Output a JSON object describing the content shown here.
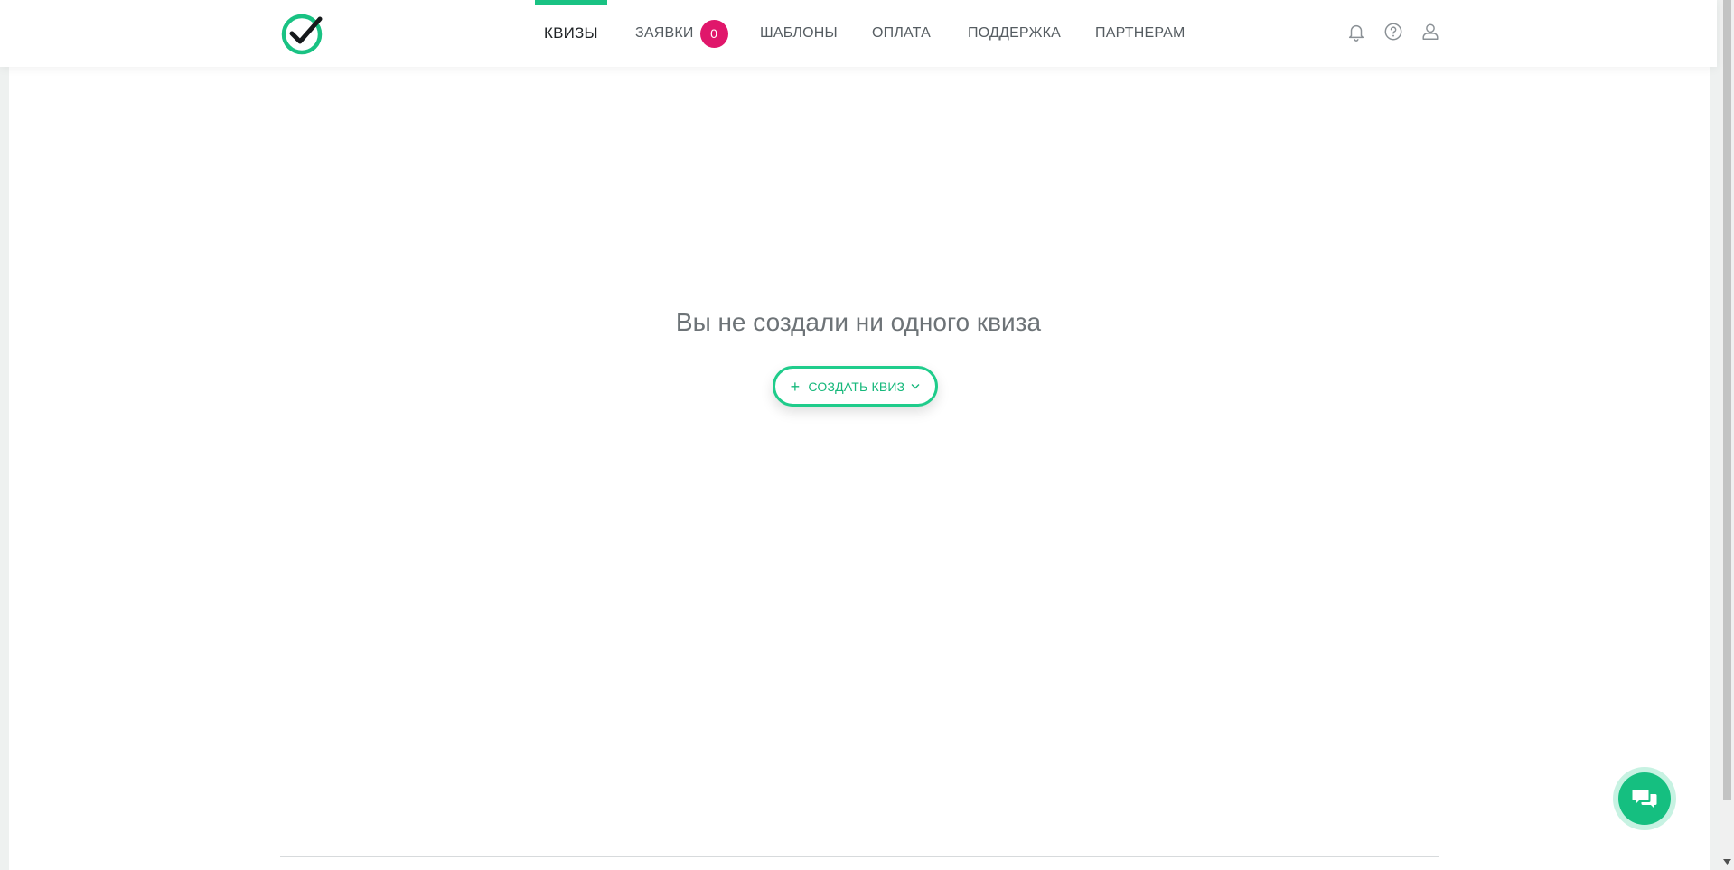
{
  "header": {
    "nav": [
      {
        "label": "КВИЗЫ",
        "active": true
      },
      {
        "label": "ЗАЯВКИ",
        "badge": "0"
      },
      {
        "label": "ШАБЛОНЫ"
      },
      {
        "label": "ОПЛАТА"
      },
      {
        "label": "ПОДДЕРЖКА"
      },
      {
        "label": "ПАРТНЕРАМ"
      }
    ],
    "icons": [
      "bell-icon",
      "help-icon",
      "user-icon"
    ]
  },
  "main": {
    "empty_title": "Вы не создали ни одного квиза",
    "create_button": {
      "icon": "+",
      "label": "СОЗДАТЬ КВИЗ"
    }
  },
  "colors": {
    "accent": "#19c283",
    "badge": "#e0176b",
    "text_muted": "#6d7377"
  }
}
